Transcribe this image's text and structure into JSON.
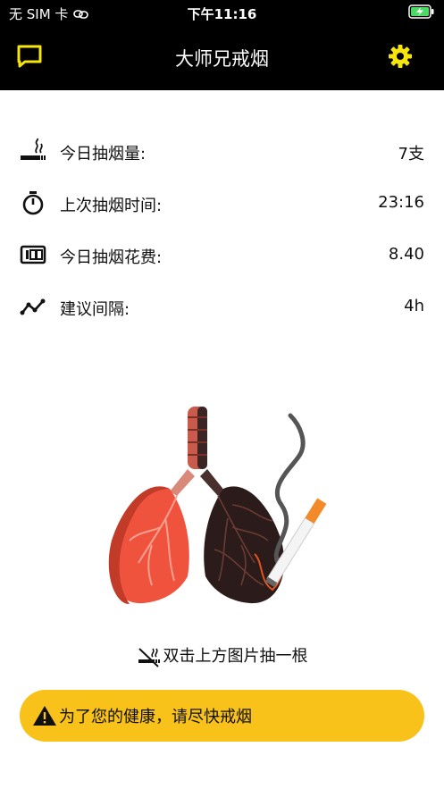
{
  "status_bar": {
    "carrier": "无 SIM 卡",
    "time": "下午11:16"
  },
  "nav": {
    "title": "大师兄戒烟"
  },
  "stats": [
    {
      "label": "今日抽烟量:",
      "value": "7支",
      "icon": "cigarette-smoke-icon"
    },
    {
      "label": "上次抽烟时间:",
      "value": "23:16",
      "icon": "stopwatch-icon"
    },
    {
      "label": "今日抽烟花费:",
      "value": "8.40",
      "icon": "counter-icon"
    },
    {
      "label": "建议间隔:",
      "value": "4h",
      "icon": "trend-line-icon"
    }
  ],
  "hint": {
    "text": "双击上方图片抽一根"
  },
  "banner": {
    "text": "为了您的健康，请尽快戒烟"
  },
  "colors": {
    "nav_bg": "#000000",
    "accent_yellow": "#f5e50a",
    "banner_yellow": "#f8c21b",
    "healthy_lung": "#f0533d",
    "smoker_lung": "#2b1b1b",
    "battery_green": "#4cd964"
  }
}
